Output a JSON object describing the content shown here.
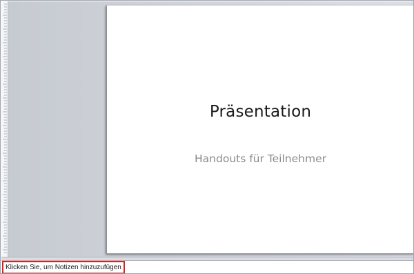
{
  "slide": {
    "title": "Präsentation",
    "subtitle": "Handouts für Teilnehmer"
  },
  "notes": {
    "placeholder": "Klicken Sie, um Notizen hinzuzufügen"
  },
  "colors": {
    "highlight_border": "#d9231f",
    "workspace": "#d3d6dc",
    "subtitle_text": "#8a8a8a"
  }
}
